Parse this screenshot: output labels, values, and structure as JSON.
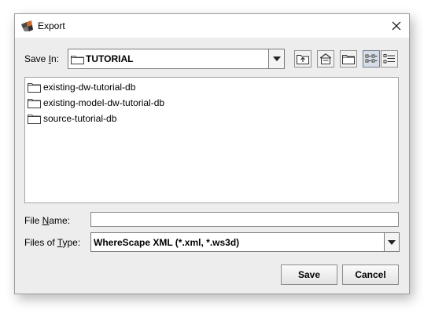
{
  "window": {
    "title": "Export",
    "icon": "wherescape-icon",
    "close_icon": "close-icon"
  },
  "save_in": {
    "label_before": "Save ",
    "label_mnemonic": "I",
    "label_after": "n:",
    "current_folder": "TUTORIAL",
    "folder_icon": "folder-icon",
    "dropdown_icon": "chevron-down-icon"
  },
  "toolbar": {
    "buttons": [
      {
        "name": "up-one-level",
        "icon": "folder-up-icon"
      },
      {
        "name": "home",
        "icon": "home-icon"
      },
      {
        "name": "new-folder",
        "icon": "new-folder-icon"
      },
      {
        "name": "list-view",
        "icon": "list-view-icon",
        "selected": true
      },
      {
        "name": "details-view",
        "icon": "details-view-icon",
        "selected": false
      }
    ]
  },
  "file_list": {
    "items": [
      {
        "label": "existing-dw-tutorial-db",
        "icon": "folder-icon"
      },
      {
        "label": "existing-model-dw-tutorial-db",
        "icon": "folder-icon"
      },
      {
        "label": "source-tutorial-db",
        "icon": "folder-icon"
      }
    ]
  },
  "file_name": {
    "label_before": "File ",
    "label_mnemonic": "N",
    "label_after": "ame:",
    "value": ""
  },
  "file_type": {
    "label_before": "Files of ",
    "label_mnemonic": "T",
    "label_after": "ype:",
    "selected": "WhereScape XML (*.xml, *.ws3d)"
  },
  "buttons": {
    "save": "Save",
    "cancel": "Cancel"
  },
  "colors": {
    "dialog_bg": "#ededed",
    "title_bg": "#ffffff",
    "selected_toggle": "#d6dde6"
  }
}
